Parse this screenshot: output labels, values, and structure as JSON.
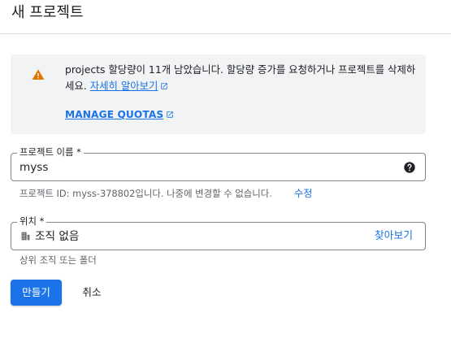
{
  "header": {
    "title": "새 프로젝트"
  },
  "quota_warning": {
    "message": "projects 할당량이 11개 남았습니다. 할당량 증가를 요청하거나 프로젝트를 삭제하세요.",
    "learn_more_label": "자세히 알아보기",
    "manage_quotas_label": "MANAGE QUOTAS",
    "icon": "warning-icon",
    "icon_color": "#e37400"
  },
  "project_name": {
    "label": "프로젝트 이름 *",
    "value": "myss",
    "help_icon": "help-icon",
    "hint_prefix": "프로젝트 ID: myss-378802입니다. 나중에 변경할 수 없습니다.",
    "edit_label": "수정"
  },
  "location": {
    "label": "위치 *",
    "value": "조직 없음",
    "icon": "organization-icon",
    "browse_label": "찾아보기",
    "hint": "상위 조직 또는 폴더"
  },
  "actions": {
    "create_label": "만들기",
    "cancel_label": "취소"
  },
  "colors": {
    "accent": "#1a73e8",
    "warning": "#e37400",
    "panel_background": "#f1f3f4"
  }
}
